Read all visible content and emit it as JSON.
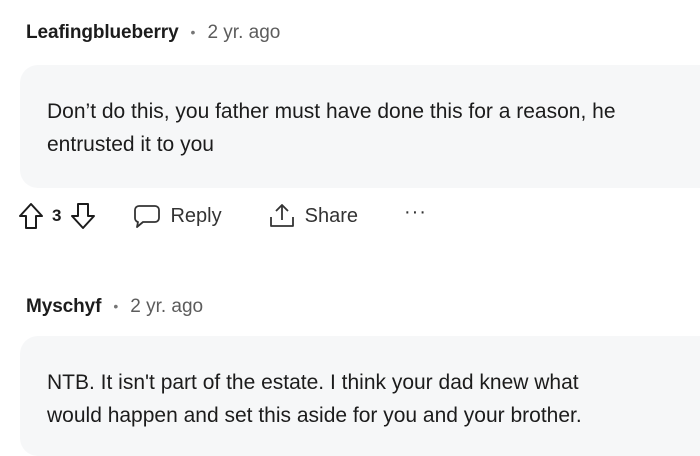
{
  "comments": [
    {
      "author": "Leafingblueberry",
      "separator": "•",
      "time": "2 yr. ago",
      "body_lines": [
        "Don’t do this, you father must have done this for a reason, he",
        "entrusted it to you"
      ],
      "votes": "3",
      "reply_label": "Reply",
      "share_label": "Share",
      "more_label": "···"
    },
    {
      "author": "Myschyf",
      "separator": "•",
      "time": "2 yr. ago",
      "body_lines": [
        "NTB. It isn't part of the estate. I think your dad knew what",
        "would happen and set this aside for you and your brother."
      ]
    }
  ]
}
